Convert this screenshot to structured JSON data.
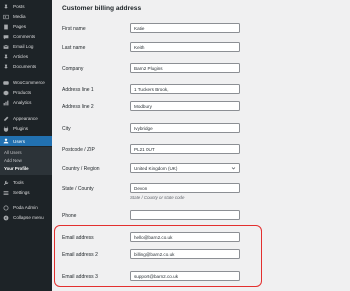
{
  "sidebar": {
    "items": [
      {
        "label": "Posts",
        "icon": "pin-icon"
      },
      {
        "label": "Media",
        "icon": "media-icon"
      },
      {
        "label": "Pages",
        "icon": "pages-icon"
      },
      {
        "label": "Comments",
        "icon": "comments-icon"
      },
      {
        "label": "Email Log",
        "icon": "email-icon"
      },
      {
        "label": "Articles",
        "icon": "pin-icon"
      },
      {
        "label": "Documents",
        "icon": "pin-icon"
      },
      {
        "label": "WooCommerce",
        "icon": "woocommerce-icon"
      },
      {
        "label": "Products",
        "icon": "products-icon"
      },
      {
        "label": "Analytics",
        "icon": "analytics-icon"
      },
      {
        "label": "Appearance",
        "icon": "appearance-icon"
      },
      {
        "label": "Plugins",
        "icon": "plugins-icon"
      },
      {
        "label": "Users",
        "icon": "users-icon"
      },
      {
        "label": "Tools",
        "icon": "tools-icon"
      },
      {
        "label": "Settings",
        "icon": "settings-icon"
      },
      {
        "label": "Poda Admin",
        "icon": "poda-icon"
      },
      {
        "label": "Collapse menu",
        "icon": "collapse-icon"
      }
    ],
    "users_submenu": [
      "All Users",
      "Add New",
      "Your Profile"
    ]
  },
  "billing": {
    "title": "Customer billing address",
    "first_name": {
      "label": "First name",
      "value": "Katie"
    },
    "last_name": {
      "label": "Last name",
      "value": "Keith"
    },
    "company": {
      "label": "Company",
      "value": "Barn2 Plugins"
    },
    "address1": {
      "label": "Address line 1",
      "value": "1 Tuckers Brook,"
    },
    "address2": {
      "label": "Address line 2",
      "value": "Modbury"
    },
    "city": {
      "label": "City",
      "value": "Ivybridge"
    },
    "postcode": {
      "label": "Postcode / ZIP",
      "value": "PL21 0UT"
    },
    "country": {
      "label": "Country / Region",
      "value": "United Kingdom (UK)"
    },
    "state": {
      "label": "State / County",
      "value": "Devon",
      "description": "State / County or state code"
    },
    "phone": {
      "label": "Phone",
      "value": ""
    },
    "email1": {
      "label": "Email address",
      "value": "hello@barn2.co.uk"
    },
    "email2": {
      "label": "Email address 2",
      "value": "billing@barn2.co.uk"
    },
    "email3": {
      "label": "Email address 3",
      "value": "support@barn2.co.uk"
    }
  },
  "colors": {
    "highlight": "#e3302f",
    "sidebar_bg": "#1d2327",
    "active": "#2271b1"
  }
}
